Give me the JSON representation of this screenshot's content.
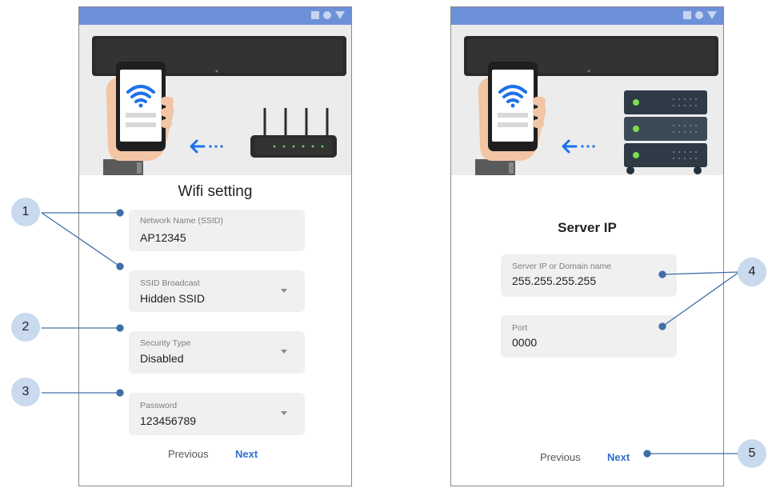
{
  "wifi_screen": {
    "title": "Wifi setting",
    "ssid": {
      "label": "Network Name (SSID)",
      "value": "AP12345"
    },
    "broadcast": {
      "label": "SSID Broadcast",
      "value": "Hidden SSID"
    },
    "security": {
      "label": "Security Type",
      "value": "Disabled"
    },
    "password": {
      "label": "Password",
      "value": "123456789"
    },
    "previous_label": "Previous",
    "next_label": "Next"
  },
  "server_screen": {
    "title": "Server IP",
    "server": {
      "label": "Server IP  or  Domain name",
      "value": "255.255.255.255"
    },
    "port": {
      "label": "Port",
      "value": "0000"
    },
    "previous_label": "Previous",
    "next_label": "Next"
  },
  "callouts": [
    "1",
    "2",
    "3",
    "4",
    "5"
  ],
  "colors": {
    "status_bar": "#6d91d9",
    "accent": "#2f6fd1",
    "callout": "#c9d9ee",
    "callout_line": "#3f6fa8"
  }
}
